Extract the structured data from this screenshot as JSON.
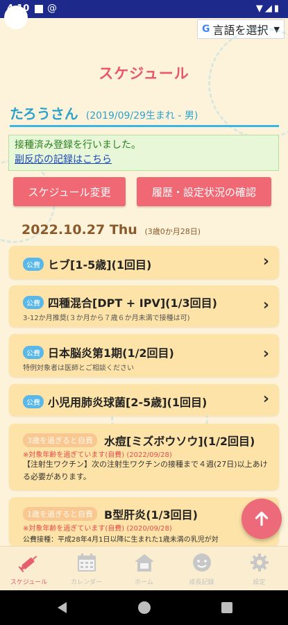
{
  "status_bar": {
    "time": "4:10",
    "icons": "▼◢▮"
  },
  "translate": {
    "g_icon": "G",
    "label": "言語を選択",
    "arrow": "▼"
  },
  "page_title": "スケジュール",
  "child": {
    "name": "たろうさん",
    "info": "(2019/09/29生まれ - 男)"
  },
  "notice": {
    "message": "接種済み登録を行いました。",
    "link": "副反応の記録はこちら"
  },
  "buttons": {
    "schedule": "スケジュール変更",
    "history": "履歴・設定状況の確認"
  },
  "date": {
    "label": "2022.10.27 Thu",
    "age": "(3歳0か月28日)"
  },
  "vaccines": [
    {
      "badge": "公費",
      "name": "ヒブ[1-5歳](1回目)"
    },
    {
      "badge": "公費",
      "name": "四種混合[DPT + IPV](1/3回目)",
      "note": "3-12か月推奨(３か月から７歳６か月未満で接種は可)"
    },
    {
      "badge": "公費",
      "name": "日本脳炎第1期(1/2回目)",
      "note": "特例対象者は医師とご相談ください"
    },
    {
      "badge": "公費",
      "name": "小児用肺炎球菌[2-5歳](1回目)"
    },
    {
      "badge": "3歳を過ぎると自費",
      "name": "水痘[ミズボウソウ](1/2回目)",
      "warn": "※対象年齢を過ぎています(自費) (2022/09/28)",
      "detail": "【注射生ワクチン】次の注射生ワクチンの接種まで４週(27日)以上あける必要があります。"
    },
    {
      "badge": "1歳を過ぎると自費",
      "name": "B型肝炎(1/3回目)",
      "warn": "※対象年齢を過ぎています(自費) (2020/09/28)",
      "detail": "公費接種：平成28年4月1日以降に生まれた1歳未満の乳児が対"
    }
  ],
  "nav": {
    "schedule": "スケジュール",
    "calendar": "カレンダー",
    "home": "ホーム",
    "growth": "成長記録",
    "settings": "設定"
  },
  "colors": {
    "accent": "#ef6873",
    "brand_blue": "#2da3cc",
    "card": "#fde3a7",
    "background": "#fdf3da"
  }
}
